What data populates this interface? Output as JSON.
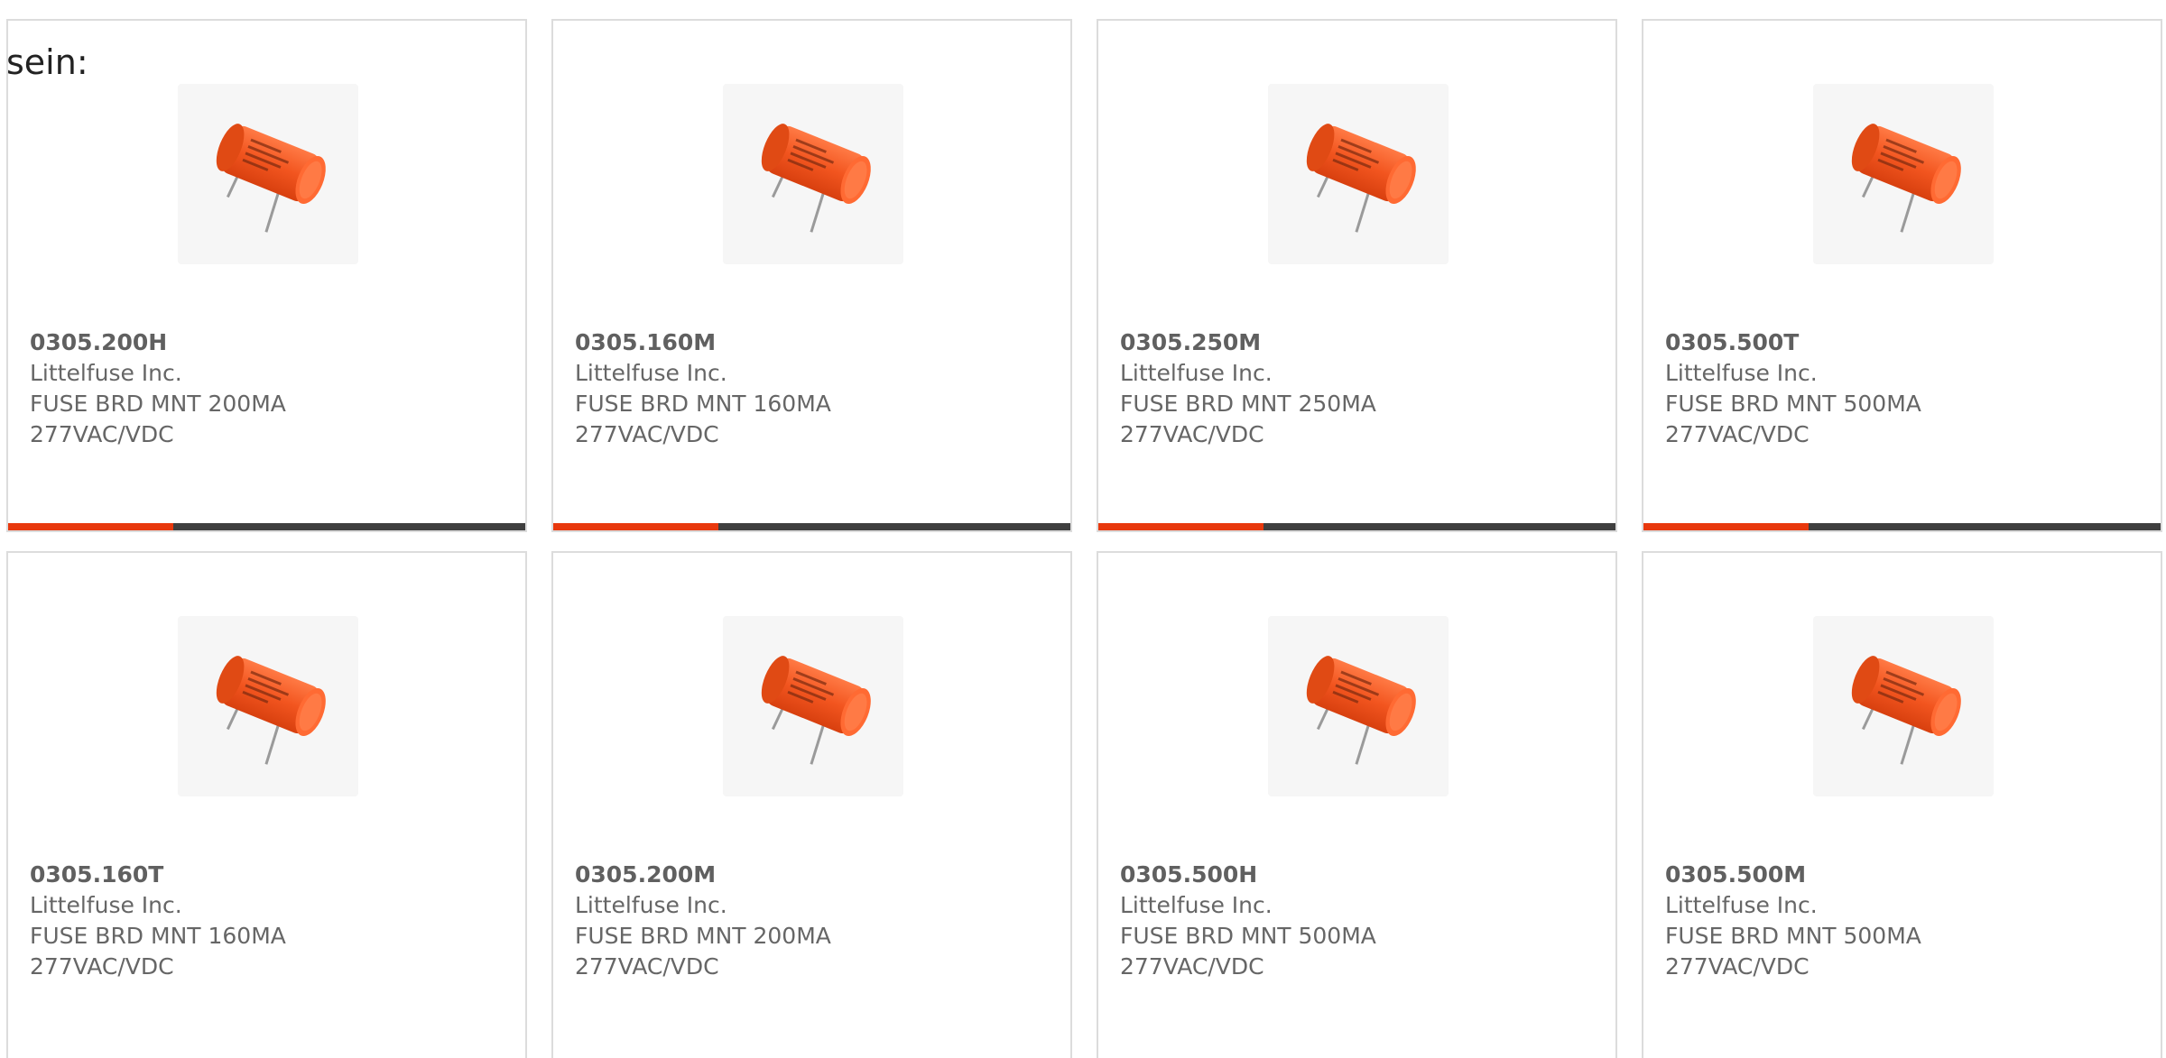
{
  "caption": "sein:",
  "accent_color": "#e8380d",
  "bar_color": "#3f3f3f",
  "products": [
    {
      "part_number": "0305.200H",
      "manufacturer": "Littelfuse Inc.",
      "description_line1": "FUSE BRD MNT 200MA",
      "description_line2": "277VAC/VDC",
      "image": "orange-fuse-icon"
    },
    {
      "part_number": "0305.160M",
      "manufacturer": "Littelfuse Inc.",
      "description_line1": "FUSE BRD MNT 160MA",
      "description_line2": "277VAC/VDC",
      "image": "orange-fuse-icon"
    },
    {
      "part_number": "0305.250M",
      "manufacturer": "Littelfuse Inc.",
      "description_line1": "FUSE BRD MNT 250MA",
      "description_line2": "277VAC/VDC",
      "image": "orange-fuse-icon"
    },
    {
      "part_number": "0305.500T",
      "manufacturer": "Littelfuse Inc.",
      "description_line1": "FUSE BRD MNT 500MA",
      "description_line2": "277VAC/VDC",
      "image": "orange-fuse-icon"
    },
    {
      "part_number": "0305.160T",
      "manufacturer": "Littelfuse Inc.",
      "description_line1": "FUSE BRD MNT 160MA",
      "description_line2": "277VAC/VDC",
      "image": "orange-fuse-icon"
    },
    {
      "part_number": "0305.200M",
      "manufacturer": "Littelfuse Inc.",
      "description_line1": "FUSE BRD MNT 200MA",
      "description_line2": "277VAC/VDC",
      "image": "orange-fuse-icon"
    },
    {
      "part_number": "0305.500H",
      "manufacturer": "Littelfuse Inc.",
      "description_line1": "FUSE BRD MNT 500MA",
      "description_line2": "277VAC/VDC",
      "image": "orange-fuse-icon"
    },
    {
      "part_number": "0305.500M",
      "manufacturer": "Littelfuse Inc.",
      "description_line1": "FUSE BRD MNT 500MA",
      "description_line2": "277VAC/VDC",
      "image": "orange-fuse-icon"
    }
  ]
}
